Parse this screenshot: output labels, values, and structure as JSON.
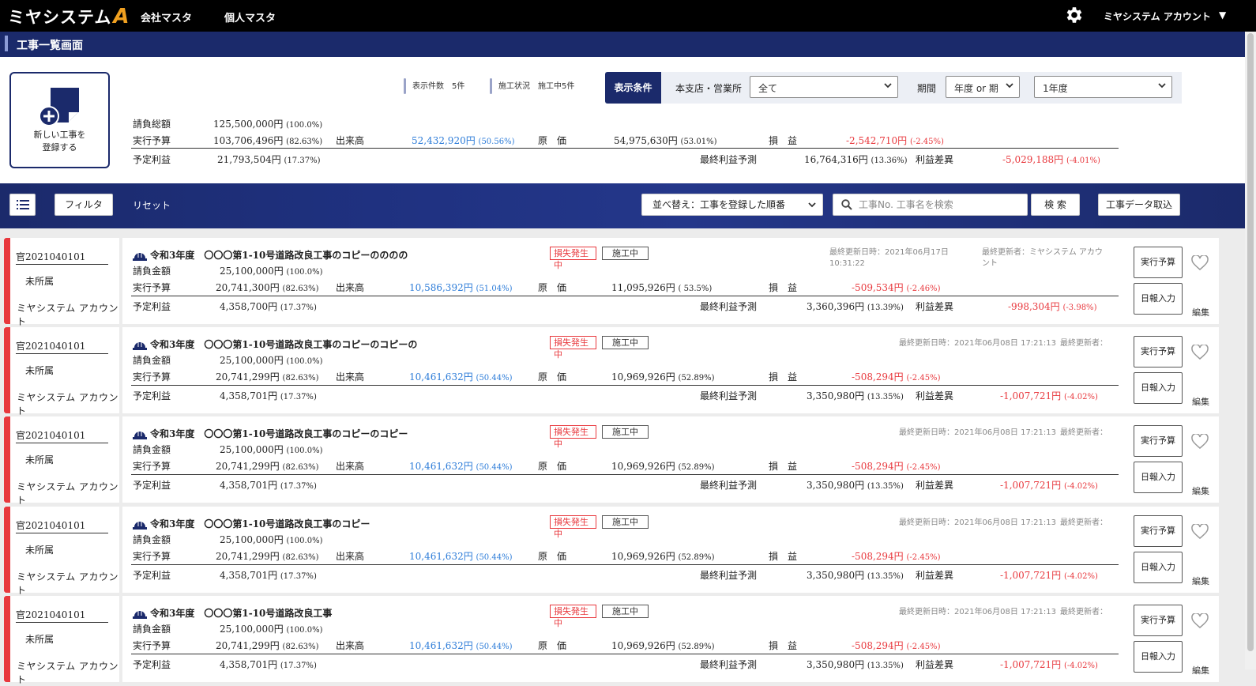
{
  "app": {
    "logo": "ミヤシステム",
    "logo_mark": "A",
    "nav": [
      "会社マスタ",
      "個人マスタ"
    ],
    "account": "ミヤシステム アカウント"
  },
  "page_title": "工事一覧画面",
  "new_button": "新しい工事を\n登録する",
  "stats": {
    "count_label": "表示件数",
    "count_value": "5件",
    "status_label": "施工状況",
    "status_value": "施工中5件"
  },
  "conditions": {
    "label": "表示条件",
    "branch_label": "本支店・営業所",
    "branch_value": "全て",
    "period_label": "期間",
    "period_type": "年度 or 期",
    "period_value": "1年度"
  },
  "totals": {
    "contract_label": "請負総額",
    "contract": "125,500,000円",
    "contract_pct": "(100.0%)",
    "budget_label": "実行予算",
    "budget": "103,706,496円",
    "budget_pct": "(82.63%)",
    "progress_label": "出来高",
    "progress": "52,432,920円",
    "progress_pct": "(50.56%)",
    "cost_label": "原　価",
    "cost": "54,975,630円",
    "cost_pct": "(53.01%)",
    "pl_label": "損　益",
    "pl": "-2,542,710円",
    "pl_pct": "(-2.45%)",
    "planned_label": "予定利益",
    "planned": "21,793,504円",
    "planned_pct": "(17.37%)",
    "final_label": "最終利益予測",
    "final": "16,764,316円",
    "final_pct": "(13.36%)",
    "diff_label": "利益差異",
    "diff": "-5,029,188円",
    "diff_pct": "(-4.01%)"
  },
  "toolbar": {
    "filter": "フィルタ",
    "reset": "リセット",
    "sort": "並べ替え：工事を登録した順番",
    "search_placeholder": "工事No. 工事名を検索",
    "search_button": "検 索",
    "import": "工事データ取込"
  },
  "labels": {
    "contract": "請負金額",
    "budget": "実行予算",
    "progress": "出来高",
    "cost": "原　価",
    "pl": "損　益",
    "planned": "予定利益",
    "final": "最終利益予測",
    "diff": "利益差異",
    "loss_tag": "損失発生中",
    "status_tag": "施工中",
    "exec_btn": "実行予算",
    "daily_btn": "日報入力",
    "edit": "編集"
  },
  "projects": [
    {
      "code": "官2021040101",
      "dept": "未所属",
      "owner": "ミヤシステム アカウント",
      "year": "令和3年度",
      "name": "〇〇〇第1-10号道路改良工事のコピーのののの",
      "updated": "最終更新日時：2021年06月17日\n10:31:22",
      "updater": "最終更新者：ミヤシステム アカウ\nント",
      "contract": "25,100,000円",
      "contract_pct": "(100.0%)",
      "budget": "20,741,300円",
      "budget_pct": "(82.63%)",
      "progress": "10,586,392円",
      "progress_pct": "(51.04%)",
      "cost": "11,095,926円",
      "cost_pct": "( 53.5%)",
      "pl": "-509,534円",
      "pl_pct": "(-2.46%)",
      "planned": "4,358,700円",
      "planned_pct": "(17.37%)",
      "final": "3,360,396円",
      "final_pct": "(13.39%)",
      "diff": "-998,304円",
      "diff_pct": "(-3.98%)"
    },
    {
      "code": "官2021040101",
      "dept": "未所属",
      "owner": "ミヤシステム アカウント",
      "year": "令和3年度",
      "name": "〇〇〇第1-10号道路改良工事のコピーのコピーの",
      "updated": "最終更新日時：2021年06月08日 17:21:13",
      "updater": "最終更新者：",
      "contract": "25,100,000円",
      "contract_pct": "(100.0%)",
      "budget": "20,741,299円",
      "budget_pct": "(82.63%)",
      "progress": "10,461,632円",
      "progress_pct": "(50.44%)",
      "cost": "10,969,926円",
      "cost_pct": "(52.89%)",
      "pl": "-508,294円",
      "pl_pct": "(-2.45%)",
      "planned": "4,358,701円",
      "planned_pct": "(17.37%)",
      "final": "3,350,980円",
      "final_pct": "(13.35%)",
      "diff": "-1,007,721円",
      "diff_pct": "(-4.02%)"
    },
    {
      "code": "官2021040101",
      "dept": "未所属",
      "owner": "ミヤシステム アカウント",
      "year": "令和3年度",
      "name": "〇〇〇第1-10号道路改良工事のコピーのコピー",
      "updated": "最終更新日時：2021年06月08日 17:21:13",
      "updater": "最終更新者：",
      "contract": "25,100,000円",
      "contract_pct": "(100.0%)",
      "budget": "20,741,299円",
      "budget_pct": "(82.63%)",
      "progress": "10,461,632円",
      "progress_pct": "(50.44%)",
      "cost": "10,969,926円",
      "cost_pct": "(52.89%)",
      "pl": "-508,294円",
      "pl_pct": "(-2.45%)",
      "planned": "4,358,701円",
      "planned_pct": "(17.37%)",
      "final": "3,350,980円",
      "final_pct": "(13.35%)",
      "diff": "-1,007,721円",
      "diff_pct": "(-4.02%)"
    },
    {
      "code": "官2021040101",
      "dept": "未所属",
      "owner": "ミヤシステム アカウント",
      "year": "令和3年度",
      "name": "〇〇〇第1-10号道路改良工事のコピー",
      "updated": "最終更新日時：2021年06月08日 17:21:13",
      "updater": "最終更新者：",
      "contract": "25,100,000円",
      "contract_pct": "(100.0%)",
      "budget": "20,741,299円",
      "budget_pct": "(82.63%)",
      "progress": "10,461,632円",
      "progress_pct": "(50.44%)",
      "cost": "10,969,926円",
      "cost_pct": "(52.89%)",
      "pl": "-508,294円",
      "pl_pct": "(-2.45%)",
      "planned": "4,358,701円",
      "planned_pct": "(17.37%)",
      "final": "3,350,980円",
      "final_pct": "(13.35%)",
      "diff": "-1,007,721円",
      "diff_pct": "(-4.02%)"
    },
    {
      "code": "官2021040101",
      "dept": "未所属",
      "owner": "ミヤシステム アカウント",
      "year": "令和3年度",
      "name": "〇〇〇第1-10号道路改良工事",
      "updated": "最終更新日時：2021年06月08日 17:21:13",
      "updater": "最終更新者：",
      "contract": "25,100,000円",
      "contract_pct": "(100.0%)",
      "budget": "20,741,299円",
      "budget_pct": "(82.63%)",
      "progress": "10,461,632円",
      "progress_pct": "(50.44%)",
      "cost": "10,969,926円",
      "cost_pct": "(52.89%)",
      "pl": "-508,294円",
      "pl_pct": "(-2.45%)",
      "planned": "4,358,701円",
      "planned_pct": "(17.37%)",
      "final": "3,350,980円",
      "final_pct": "(13.35%)",
      "diff": "-1,007,721円",
      "diff_pct": "(-4.02%)"
    }
  ],
  "icons": [
    "gear-icon",
    "plus-document-icon",
    "menu-list-icon",
    "search-icon",
    "helmet-icon",
    "heart-icon",
    "chevron-down-icon"
  ],
  "colors": {
    "nav": "#000000",
    "brand": "#1b2a6b",
    "accent": "#e8383d",
    "link": "#2b7bd8",
    "logo_mark": "#f0a020"
  }
}
